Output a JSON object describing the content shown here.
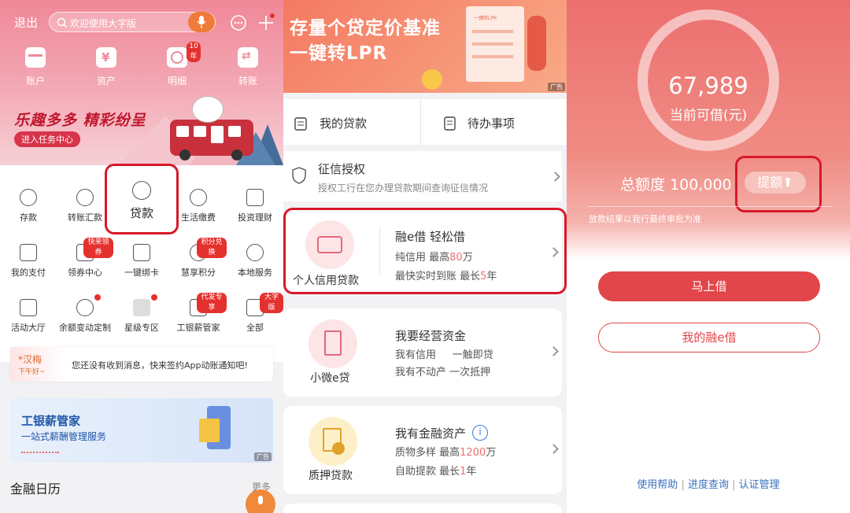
{
  "panel1": {
    "exit_label": "退出",
    "search_placeholder": "欢迎使用大字版",
    "quick": [
      {
        "label": "账户",
        "icon": "wallet-icon"
      },
      {
        "label": "资产",
        "icon": "yen-icon"
      },
      {
        "label": "明细",
        "icon": "clock-icon",
        "badge": "10年"
      },
      {
        "label": "转账",
        "icon": "transfer-icon"
      }
    ],
    "banner_slogan": "乐趣多多 精彩纷呈",
    "banner_task_button": "进入任务中心",
    "grid": [
      {
        "label": "存款",
        "icon": "piggy-bank-icon"
      },
      {
        "label": "转账汇款",
        "icon": "yen-exchange-icon"
      },
      {
        "label": "贷款",
        "icon": "loan-hand-icon"
      },
      {
        "label": "生活缴费",
        "icon": "water-drop-icon"
      },
      {
        "label": "投资理财",
        "icon": "chart-icon"
      },
      {
        "label": "我的支付",
        "icon": "payment-icon"
      },
      {
        "label": "领券中心",
        "icon": "coupon-icon",
        "badge": "快来领券"
      },
      {
        "label": "一键绑卡",
        "icon": "card-icon"
      },
      {
        "label": "慧享积分",
        "icon": "coins-icon",
        "badge": "积分兑换"
      },
      {
        "label": "本地服务",
        "icon": "local-service-icon"
      },
      {
        "label": "活动大厅",
        "icon": "gift-icon"
      },
      {
        "label": "余额变动定制",
        "icon": "balance-icon"
      },
      {
        "label": "星级专区",
        "icon": "star-icon"
      },
      {
        "label": "工银薪管家",
        "icon": "salary-icon",
        "badge": "代发专享"
      },
      {
        "label": "全部",
        "icon": "grid-icon",
        "badge": "大字版"
      }
    ],
    "notice_name": "*汉梅",
    "notice_greeting": "下午好~",
    "notice_text": "您还没有收到消息，快来签约App动账通知吧!",
    "ad_title": "工银薪管家",
    "ad_subtitle": "一站式薪酬管理服务",
    "ad_tag": "广告",
    "section_title": "金融日历",
    "section_more": "更多"
  },
  "panel2": {
    "banner_line1": "存量个贷定价基准",
    "banner_line2": "一键转LPR",
    "banner_doc_label": "一键转LPR",
    "banner_tag": "广告",
    "tab_my_loans": "我的贷款",
    "tab_todo": "待办事项",
    "credit_title": "征信授权",
    "credit_desc": "授权工行在您办理贷款期间查询征信情况",
    "personal": {
      "name": "个人信用贷款",
      "title": "融e借  轻松借",
      "line1_a": "纯信用  最高",
      "line1_b": "80",
      "line1_c": "万",
      "line2_a": "最快实时到账  最长",
      "line2_b": "5",
      "line2_c": "年"
    },
    "micro": {
      "name": "小微e贷",
      "title": "我要经营资金",
      "line1_a": "我有信用",
      "line1_b": "一触即贷",
      "line2_a": "我有不动产",
      "line2_b": "一次抵押"
    },
    "pledge": {
      "name": "质押贷款",
      "title": "我有金融资产",
      "line1_a": "质物多样  最高",
      "line1_b": "1200",
      "line1_c": "万",
      "line2_a": "自助提款  最长",
      "line2_b": "1",
      "line2_c": "年"
    }
  },
  "panel3": {
    "amount": "67,989",
    "amount_label": "当前可借(元)",
    "total_label": "总额度",
    "total_value": "100,000",
    "raise_button": "提额",
    "disclaimer": "放款结果以我行最终审批为准",
    "borrow_now": "马上借",
    "my_rongejie": "我的融e借",
    "footer_help": "使用帮助",
    "footer_progress": "进度查询",
    "footer_auth": "认证管理",
    "footer_sep": "|"
  },
  "colors": {
    "brand_red": "#e2464a",
    "highlight": "#d7182a",
    "pink": "#f08898"
  }
}
